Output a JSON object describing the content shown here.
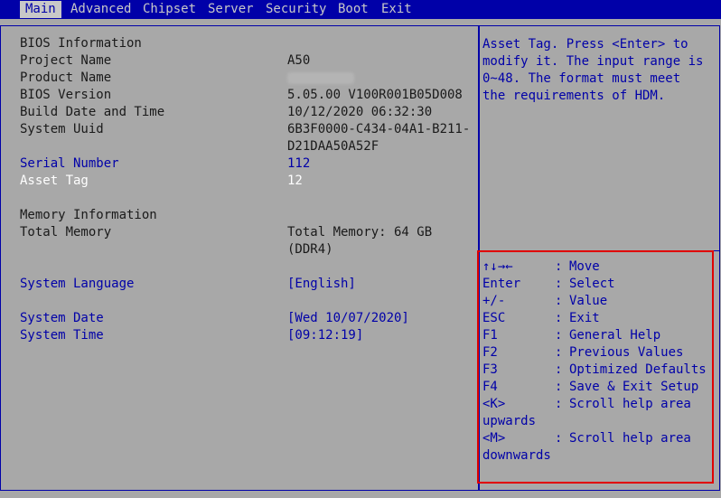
{
  "tabs": [
    "Main",
    "Advanced",
    "Chipset",
    "Server",
    "Security",
    "Boot",
    "Exit"
  ],
  "active_tab": "Main",
  "bios_info": {
    "heading": "BIOS Information",
    "project_name_label": "Project Name",
    "project_name_value": "A50",
    "product_name_label": "Product Name",
    "bios_version_label": "BIOS Version",
    "bios_version_value": "5.05.00 V100R001B05D008",
    "build_label": "Build Date and Time",
    "build_value": "10/12/2020 06:32:30",
    "uuid_label": "System Uuid",
    "uuid_value_line1": "6B3F0000-C434-04A1-B211-",
    "uuid_value_line2": "D21DAA50A52F",
    "serial_label": "Serial Number",
    "serial_value": "112",
    "asset_label": "Asset Tag",
    "asset_value": "12"
  },
  "memory_info": {
    "heading": "Memory Information",
    "total_label": "Total Memory",
    "total_value_line1": "Total Memory:   64 GB",
    "total_value_line2": "(DDR4)"
  },
  "settings": {
    "language_label": "System Language",
    "language_value": "[English]",
    "date_label": "System Date",
    "date_value": "[Wed 10/07/2020]",
    "time_label": "System Time",
    "time_value": "[09:12:19]"
  },
  "help_text": "Asset Tag. Press <Enter> to modify it. The input range is 0~48. The format must meet the requirements of HDM.",
  "keys": [
    {
      "key": "↑↓→←",
      "desc": "Move"
    },
    {
      "key": "Enter",
      "desc": "Select"
    },
    {
      "key": "+/-",
      "desc": "Value"
    },
    {
      "key": "ESC",
      "desc": "Exit"
    },
    {
      "key": "F1",
      "desc": "General Help"
    },
    {
      "key": "F2",
      "desc": "Previous Values"
    },
    {
      "key": "F3",
      "desc": "Optimized Defaults"
    },
    {
      "key": "F4",
      "desc": "Save & Exit Setup"
    }
  ],
  "scroll_keys": [
    {
      "key": "<K>",
      "desc": "Scroll help area",
      "wrap": "upwards"
    },
    {
      "key": "<M>",
      "desc": "Scroll help area",
      "wrap": "downwards"
    }
  ],
  "key_separator": ":",
  "colors": {
    "accent_blue": "#0000a8",
    "background": "#a8a8a8",
    "highlight_box": "#e00000"
  }
}
